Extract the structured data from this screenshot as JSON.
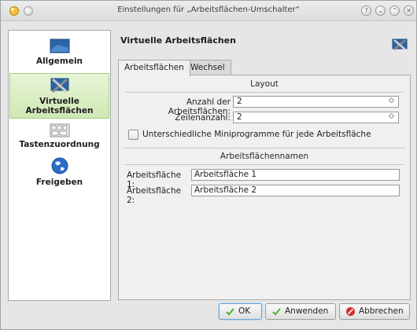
{
  "window": {
    "title": "Einstellungen für „Arbeitsflächen-Umschalter“"
  },
  "sidebar": {
    "items": [
      {
        "label": "Allgemein",
        "icon": "monitor-icon",
        "selected": false
      },
      {
        "label": "Virtuelle Arbeitsflächen",
        "icon": "desktop-tools-icon",
        "selected": true
      },
      {
        "label": "Tastenzuordnung",
        "icon": "keyboard-icon",
        "selected": false
      },
      {
        "label": "Freigeben",
        "icon": "globe-icon",
        "selected": false
      }
    ]
  },
  "main": {
    "title": "Virtuelle Arbeitsflächen",
    "tabs": [
      {
        "label": "Arbeitsflächen",
        "active": true
      },
      {
        "label": "Wechsel",
        "active": false
      }
    ],
    "layout": {
      "heading": "Layout",
      "count_label": "Anzahl der Arbeitsflächen:",
      "count_value": "2",
      "rows_label": "Zeilenanzahl:",
      "rows_value": "2",
      "different_widgets_label": "Unterschiedliche Miniprogramme für jede Arbeitsfläche",
      "different_widgets_checked": false
    },
    "names": {
      "heading": "Arbeitsflächennamen",
      "entries": [
        {
          "label": "Arbeitsfläche 1:",
          "value": "Arbeitsfläche 1"
        },
        {
          "label": "Arbeitsfläche 2:",
          "value": "Arbeitsfläche 2"
        }
      ]
    }
  },
  "buttons": {
    "ok": "OK",
    "apply": "Anwenden",
    "cancel": "Abbrechen"
  },
  "colors": {
    "selected_bg": "#cfe8b4",
    "ok_check": "#4caf2e",
    "cancel_red": "#d22b2b"
  }
}
